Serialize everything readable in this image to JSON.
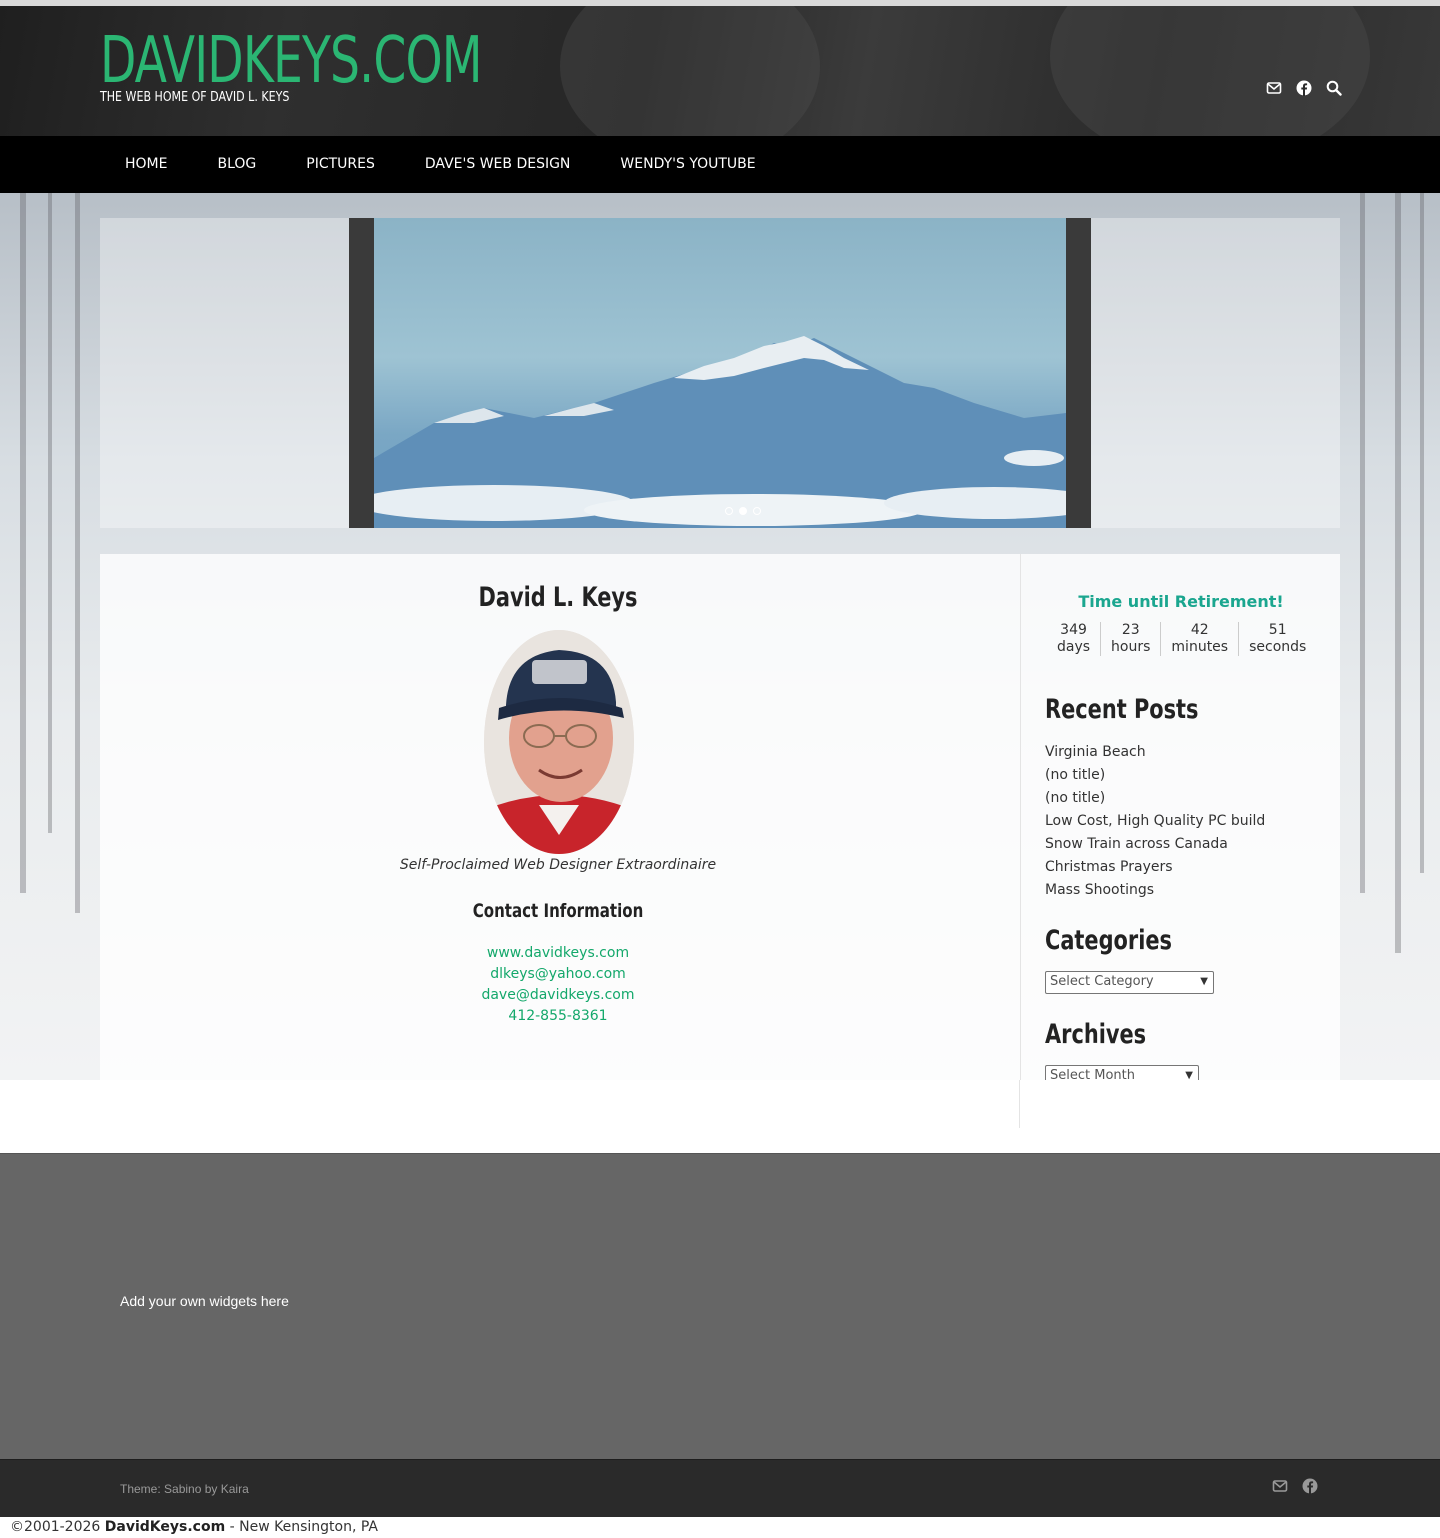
{
  "site": {
    "title": "DAVIDKEYS.COM",
    "tagline": "THE WEB HOME OF DAVID L. KEYS",
    "accent_color": "#2bb673"
  },
  "header_icons": [
    "envelope-icon",
    "facebook-icon",
    "search-icon"
  ],
  "nav": {
    "items": [
      "HOME",
      "BLOG",
      "PICTURES",
      "DAVE'S WEB DESIGN",
      "WENDY'S YOUTUBE"
    ]
  },
  "slider": {
    "slide_count": 3,
    "active_slide": 2
  },
  "main": {
    "title": "David L. Keys",
    "caption": "Self-Proclaimed Web Designer Extraordinaire",
    "contact_title": "Contact Information",
    "contacts": [
      "www.davidkeys.com",
      "dlkeys@yahoo.com",
      "dave@davidkeys.com",
      "412-855-8361"
    ],
    "link_color": "#14a86b"
  },
  "sidebar": {
    "countdown": {
      "title": "Time until Retirement!",
      "title_color": "#1ba68f",
      "units": [
        {
          "value": "349",
          "label": "days"
        },
        {
          "value": "23",
          "label": "hours"
        },
        {
          "value": "42",
          "label": "minutes"
        },
        {
          "value": "51",
          "label": "seconds"
        }
      ]
    },
    "recent_posts": {
      "title": "Recent Posts",
      "items": [
        "Virginia Beach",
        "(no title)",
        "(no title)",
        "Low Cost, High Quality PC build",
        "Snow Train across Canada",
        "Christmas Prayers",
        "Mass Shootings"
      ]
    },
    "categories": {
      "title": "Categories",
      "selected": "Select Category"
    },
    "archives": {
      "title": "Archives",
      "selected": "Select Month"
    }
  },
  "footer": {
    "widgets_message": "Add your own widgets here",
    "credit": "Theme: Sabino by Kaira",
    "icons": [
      "envelope-icon",
      "facebook-icon"
    ]
  },
  "copyright": {
    "prefix": "©2001-2026 ",
    "site": "DavidKeys.com",
    "suffix": " - New Kensington, PA"
  }
}
